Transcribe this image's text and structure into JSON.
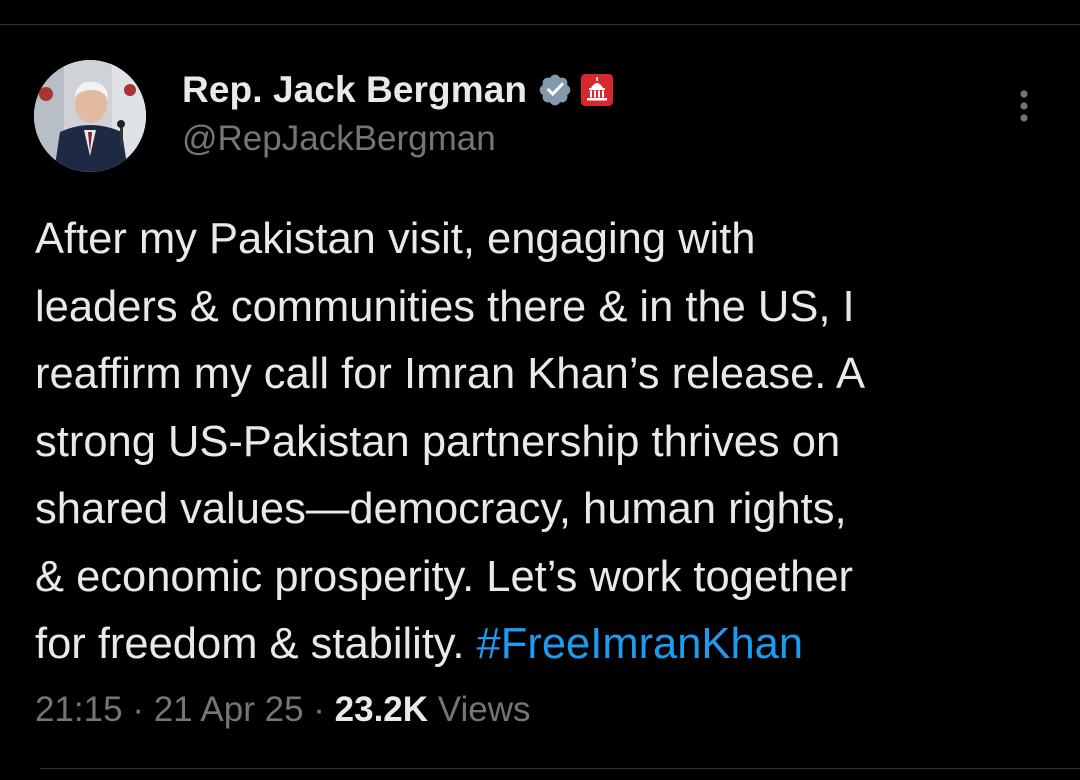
{
  "author": {
    "display_name": "Rep. Jack Bergman",
    "handle": "@RepJackBergman",
    "verified_icon": "verified-badge-icon",
    "affiliation_icon": "capitol-badge-icon"
  },
  "tweet": {
    "text": "After my Pakistan visit, engaging with\nleaders & communities there & in the US, I\nreaffirm my call for Imran Khan’s release. A\nstrong US-Pakistan partnership thrives on\nshared values—democracy, human rights,\n& economic prosperity. Let’s work together\nfor freedom & stability. ",
    "hashtag": "#FreeImranKhan"
  },
  "meta": {
    "time": "21:15",
    "separator": " · ",
    "date": "21 Apr 25",
    "views_count": "23.2K",
    "views_label": " Views"
  },
  "colors": {
    "background": "#000000",
    "text_primary": "#e7e9ea",
    "text_secondary": "#71767b",
    "link": "#1d9bf0",
    "verified": "#829aab",
    "affiliation_badge": "#d9272e"
  }
}
